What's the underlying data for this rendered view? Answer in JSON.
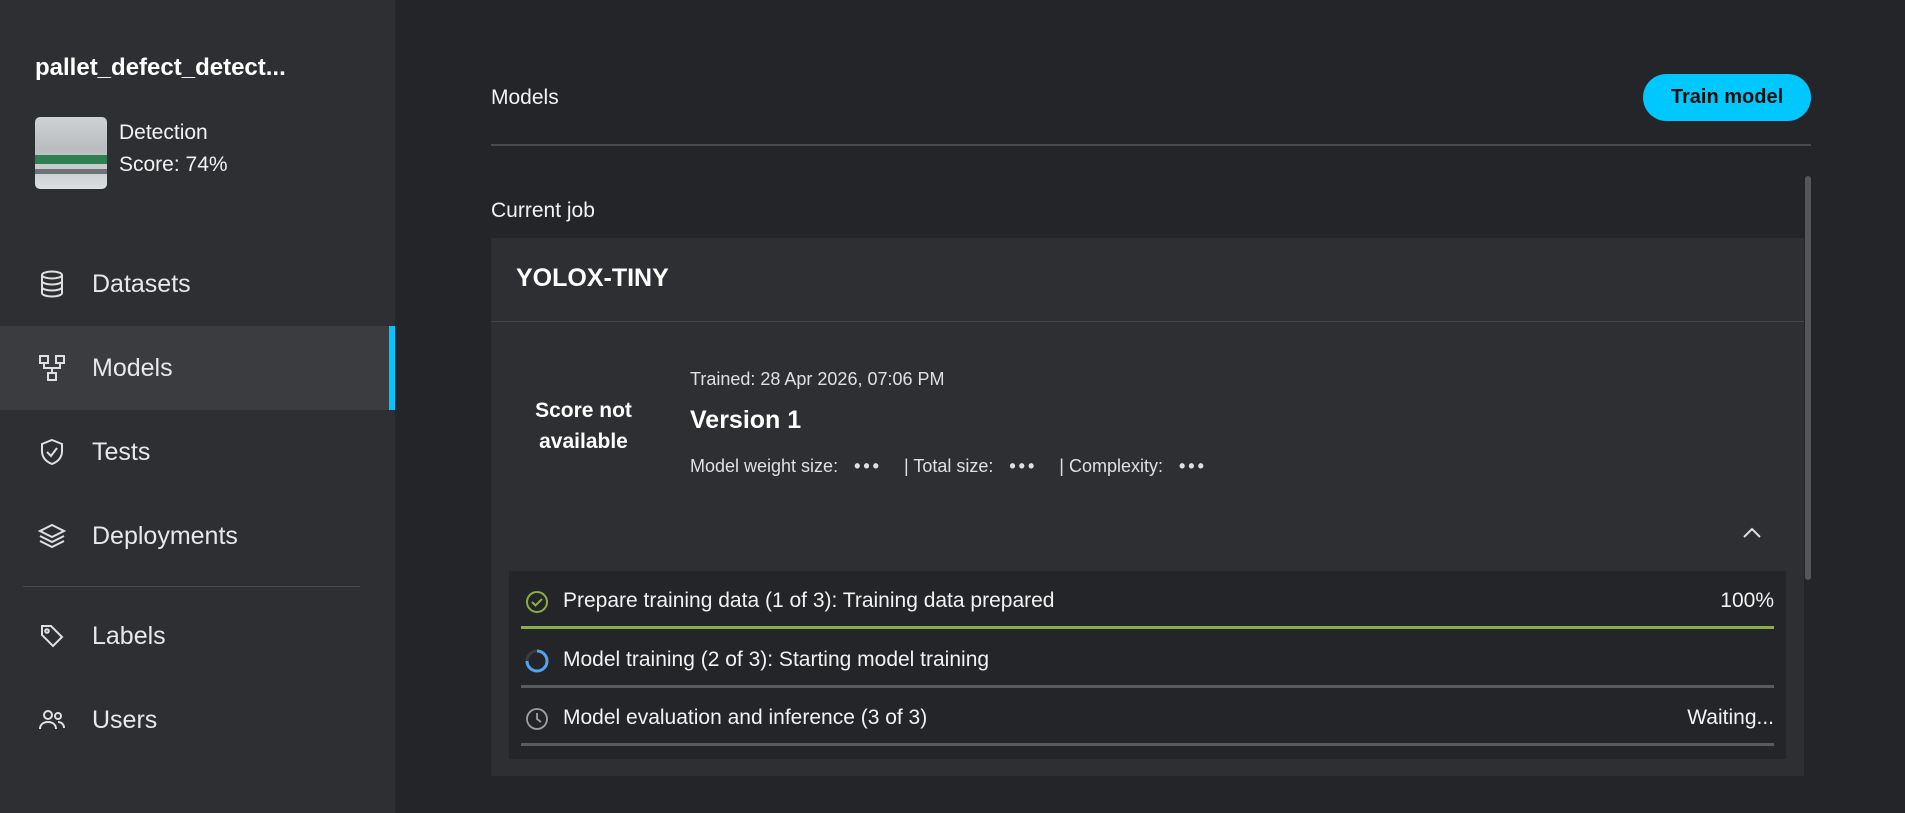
{
  "sidebar": {
    "project": {
      "name": "pallet_defect_detect...",
      "type": "Detection",
      "score": "Score: 74%"
    },
    "items": [
      {
        "label": "Datasets",
        "icon": "database-icon"
      },
      {
        "label": "Models",
        "icon": "models-icon",
        "active": true
      },
      {
        "label": "Tests",
        "icon": "shield-check-icon"
      },
      {
        "label": "Deployments",
        "icon": "layers-icon"
      },
      {
        "label": "Labels",
        "icon": "tags-icon"
      },
      {
        "label": "Users",
        "icon": "users-icon"
      }
    ]
  },
  "main": {
    "title": "Models",
    "train_button": "Train model",
    "current_job_label": "Current job",
    "job": {
      "model_name": "YOLOX-TINY",
      "score_text": "Score not available",
      "trained": "Trained: 28 Apr 2026, 07:06 PM",
      "version": "Version 1",
      "weight_size_label": "Model weight size:",
      "total_size_label": "| Total size:",
      "complexity_label": "| Complexity:",
      "loading": "•••",
      "steps": [
        {
          "label": "Prepare training data (1 of 3): Training data prepared",
          "status": "100%",
          "state": "done",
          "progress": 1.0
        },
        {
          "label": "Model training (2 of 3): Starting model training",
          "status": "",
          "state": "running",
          "progress": 0.0
        },
        {
          "label": "Model evaluation and inference (3 of 3)",
          "status": "Waiting...",
          "state": "waiting",
          "progress": 0.0
        }
      ]
    }
  },
  "colors": {
    "accent": "#00c7fd",
    "success": "#8bae46",
    "running": "#4ea3f2"
  }
}
